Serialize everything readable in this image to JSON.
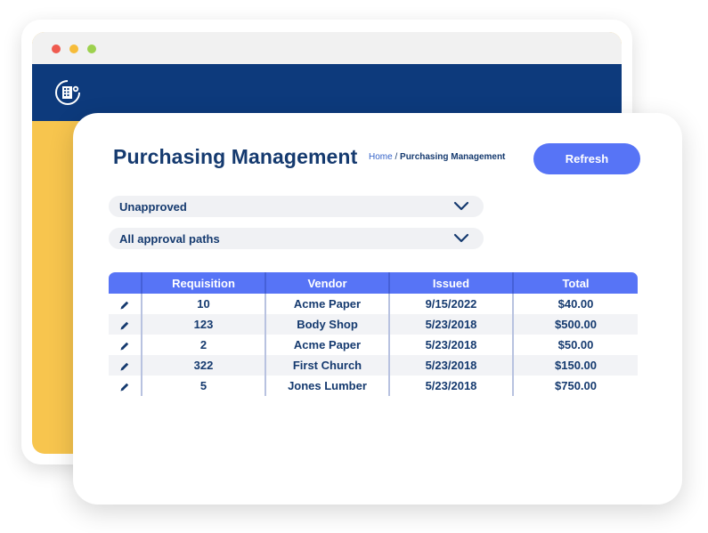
{
  "window": {
    "controls": [
      "close",
      "minimize",
      "maximize"
    ],
    "app_logo_icon": "building-globe-icon"
  },
  "page": {
    "title": "Purchasing Management",
    "breadcrumb": {
      "home": "Home",
      "separator": " / ",
      "current": "Purchasing Management"
    },
    "refresh_label": "Refresh"
  },
  "filters": {
    "status": {
      "selected": "Unapproved",
      "icon": "chevron-down-icon"
    },
    "approval_path": {
      "selected": "All approval paths",
      "icon": "chevron-down-icon"
    }
  },
  "table": {
    "columns": [
      "",
      "Requisition",
      "Vendor",
      "Issued",
      "Total"
    ],
    "row_action_icon": "pencil-icon",
    "rows": [
      {
        "requisition": "10",
        "vendor": "Acme Paper",
        "issued": "9/15/2022",
        "total": "$40.00"
      },
      {
        "requisition": "123",
        "vendor": "Body Shop",
        "issued": "5/23/2018",
        "total": "$500.00"
      },
      {
        "requisition": "2",
        "vendor": "Acme Paper",
        "issued": "5/23/2018",
        "total": "$50.00"
      },
      {
        "requisition": "322",
        "vendor": "First Church",
        "issued": "5/23/2018",
        "total": "$150.00"
      },
      {
        "requisition": "5",
        "vendor": "Jones Lumber",
        "issued": "5/23/2018",
        "total": "$750.00"
      }
    ]
  },
  "colors": {
    "navy": "#0d3a7c",
    "accent_blue": "#5774f6",
    "text_navy": "#153a6f",
    "yellow": "#f7c54e"
  }
}
